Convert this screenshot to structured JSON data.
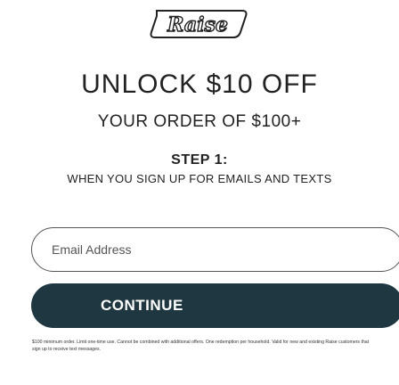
{
  "brand": {
    "logo_text": "Raise"
  },
  "offer": {
    "headline": "UNLOCK $10 OFF",
    "subhead": "YOUR ORDER OF $100+"
  },
  "step": {
    "title": "STEP 1:",
    "description": "WHEN YOU SIGN UP FOR EMAILS AND TEXTS"
  },
  "form": {
    "email_placeholder": "Email Address",
    "email_value": "",
    "continue_label": "CONTINUE"
  },
  "disclaimer": "$100 minimum order. Limit one-time use. Cannot be combined with additional offers. One redemption per household. Valid for new and existing Raise customers that sign up to receive text messages.",
  "colors": {
    "button_background": "#1f3740",
    "button_text": "#ffffff",
    "text": "#222222",
    "field_border": "#555555"
  }
}
